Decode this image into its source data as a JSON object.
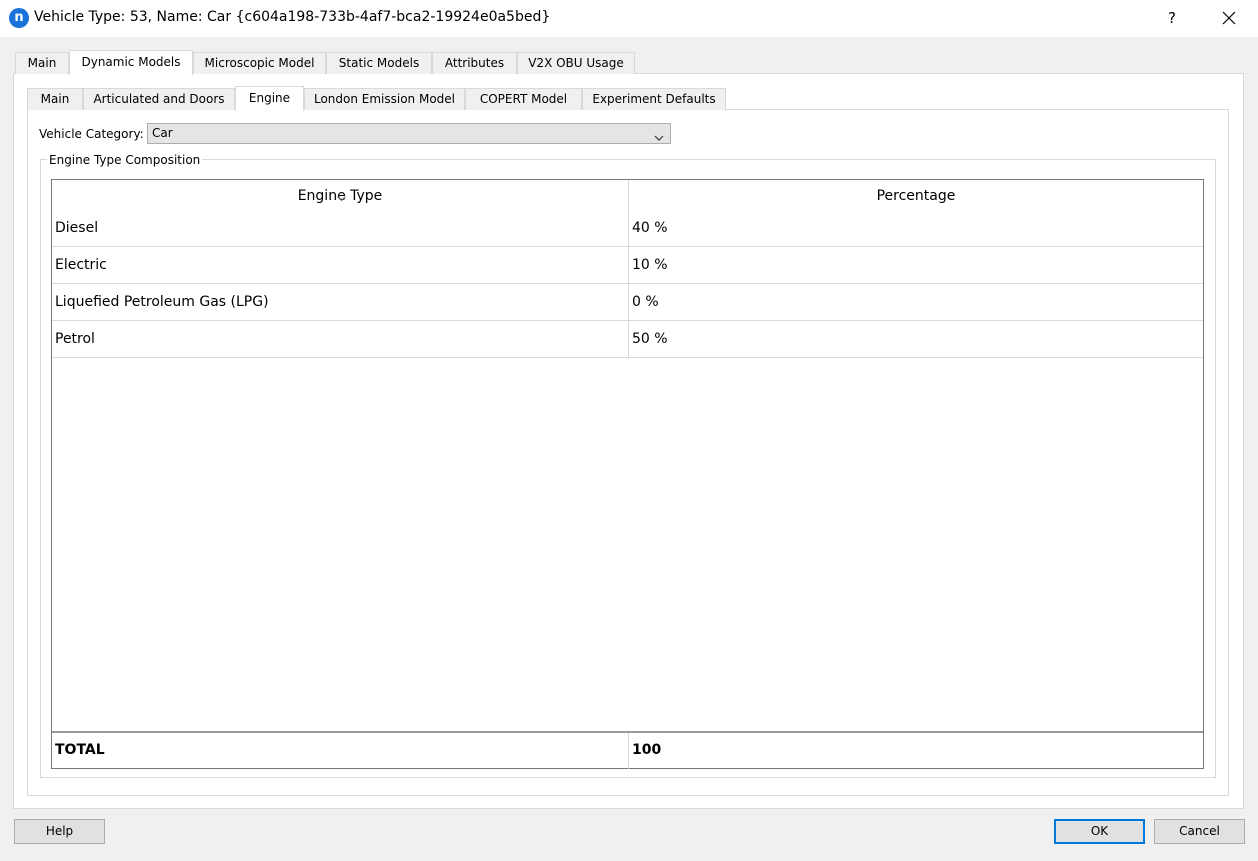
{
  "window": {
    "app_icon_letter": "n",
    "title": "Vehicle Type: 53, Name: Car  {c604a198-733b-4af7-bca2-19924e0a5bed}",
    "help_label": "?"
  },
  "outer_tabs": [
    "Main",
    "Dynamic Models",
    "Microscopic Model",
    "Static Models",
    "Attributes",
    "V2X OBU Usage"
  ],
  "outer_active": "Dynamic Models",
  "inner_tabs": [
    "Main",
    "Articulated and Doors",
    "Engine",
    "London Emission Model",
    "COPERT Model",
    "Experiment Defaults"
  ],
  "inner_active": "Engine",
  "vehicle_category": {
    "label": "Vehicle Category:",
    "value": "Car"
  },
  "group_title": "Engine Type Composition",
  "table": {
    "headers": [
      "Engine Type",
      "Percentage"
    ],
    "rows": [
      {
        "engine": "Diesel",
        "percentage": "40 %"
      },
      {
        "engine": "Electric",
        "percentage": "10 %"
      },
      {
        "engine": "Liquefied Petroleum Gas (LPG)",
        "percentage": "0 %"
      },
      {
        "engine": "Petrol",
        "percentage": "50 %"
      }
    ],
    "total_label": "TOTAL",
    "total_value": "100"
  },
  "buttons": {
    "help": "Help",
    "ok": "OK",
    "cancel": "Cancel"
  },
  "colors": {
    "accent": "#0078d7",
    "app_icon": "#1a73d9"
  }
}
